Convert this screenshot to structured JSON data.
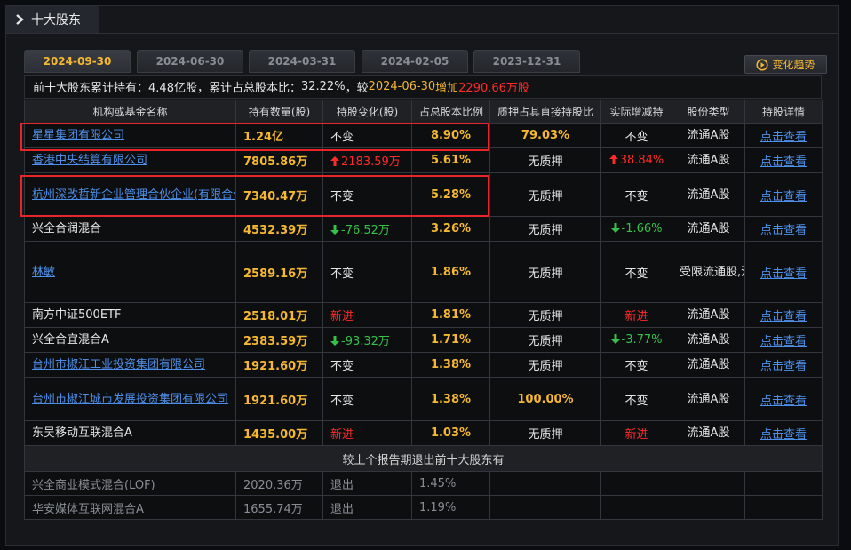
{
  "window": {
    "title": "十大股东"
  },
  "tabs": [
    {
      "label": "2024-09-30",
      "active": true
    },
    {
      "label": "2024-06-30",
      "active": false
    },
    {
      "label": "2024-03-31",
      "active": false
    },
    {
      "label": "2024-02-05",
      "active": false
    },
    {
      "label": "2023-12-31",
      "active": false
    }
  ],
  "trend_button": {
    "label": "变化趋势",
    "icon": "play-circle-icon"
  },
  "summary": {
    "prefix": "前十大股东累计持有：",
    "held": "4.48亿股",
    "mid": "，累计占总股本比：",
    "ratio": "32.22%",
    "mid2": "，较",
    "compare_date": "2024-06-30",
    "change_word": "增加",
    "change_value": "2290.66万股"
  },
  "table": {
    "headers": [
      "机构或基金名称",
      "持有数量(股)",
      "持股变化(股)",
      "占总股本比例",
      "质押占其直接持股比",
      "实际增减持",
      "股份类型",
      "持股详情"
    ],
    "rows": [
      {
        "name": "星星集团有限公司",
        "link": true,
        "amount": "1.24亿",
        "change": "不变",
        "change_dir": "none",
        "ratio": "8.90%",
        "pledge": "79.03%",
        "pledge_hl": true,
        "actual": "不变",
        "actual_dir": "none",
        "type": "流通A股",
        "detail": "点击查看"
      },
      {
        "name": "香港中央结算有限公司",
        "link": true,
        "amount": "7805.86万",
        "change": "2183.59万",
        "change_dir": "up",
        "ratio": "5.61%",
        "pledge": "无质押",
        "pledge_hl": false,
        "actual": "38.84%",
        "actual_dir": "up",
        "type": "流通A股",
        "detail": "点击查看"
      },
      {
        "name": "杭州深改哲新企业管理合伙企业(有限合伙)",
        "link": true,
        "amount": "7340.47万",
        "change": "不变",
        "change_dir": "none",
        "ratio": "5.28%",
        "pledge": "无质押",
        "pledge_hl": false,
        "actual": "不变",
        "actual_dir": "none",
        "type": "流通A股",
        "detail": "点击查看"
      },
      {
        "name": "兴全合润混合",
        "link": false,
        "amount": "4532.39万",
        "change": "-76.52万",
        "change_dir": "down",
        "ratio": "3.26%",
        "pledge": "无质押",
        "pledge_hl": false,
        "actual": "-1.66%",
        "actual_dir": "down",
        "type": "流通A股",
        "detail": "点击查看"
      },
      {
        "name": "林敏",
        "link": true,
        "amount": "2589.16万",
        "change": "不变",
        "change_dir": "none",
        "ratio": "1.86%",
        "pledge": "无质押",
        "pledge_hl": false,
        "actual": "不变",
        "actual_dir": "none",
        "type": "受限流通股,流通A股",
        "detail": "点击查看"
      },
      {
        "name": "南方中证500ETF",
        "link": false,
        "amount": "2518.01万",
        "change": "新进",
        "change_dir": "new",
        "ratio": "1.81%",
        "pledge": "无质押",
        "pledge_hl": false,
        "actual": "新进",
        "actual_dir": "new",
        "type": "流通A股",
        "detail": "点击查看"
      },
      {
        "name": "兴全合宜混合A",
        "link": false,
        "amount": "2383.59万",
        "change": "-93.32万",
        "change_dir": "down",
        "ratio": "1.71%",
        "pledge": "无质押",
        "pledge_hl": false,
        "actual": "-3.77%",
        "actual_dir": "down",
        "type": "流通A股",
        "detail": "点击查看"
      },
      {
        "name": "台州市椒江工业投资集团有限公司",
        "link": true,
        "amount": "1921.60万",
        "change": "不变",
        "change_dir": "none",
        "ratio": "1.38%",
        "pledge": "无质押",
        "pledge_hl": false,
        "actual": "不变",
        "actual_dir": "none",
        "type": "流通A股",
        "detail": "点击查看"
      },
      {
        "name": "台州市椒江城市发展投资集团有限公司",
        "link": true,
        "amount": "1921.60万",
        "change": "不变",
        "change_dir": "none",
        "ratio": "1.38%",
        "pledge": "100.00%",
        "pledge_hl": true,
        "actual": "不变",
        "actual_dir": "none",
        "type": "流通A股",
        "detail": "点击查看"
      },
      {
        "name": "东吴移动互联混合A",
        "link": false,
        "amount": "1435.00万",
        "change": "新进",
        "change_dir": "new",
        "ratio": "1.03%",
        "pledge": "无质押",
        "pledge_hl": false,
        "actual": "新进",
        "actual_dir": "new",
        "type": "流通A股",
        "detail": "点击查看"
      }
    ],
    "exit_section_title": "较上个报告期退出前十大股东有",
    "exit_rows": [
      {
        "name": "兴全商业模式混合(LOF)",
        "amount": "2020.36万",
        "change": "退出",
        "ratio": "1.45%"
      },
      {
        "name": "华安媒体互联网混合A",
        "amount": "1655.74万",
        "change": "退出",
        "ratio": "1.19%"
      }
    ]
  },
  "colors": {
    "accent": "#f5b830",
    "up": "#ff2a2a",
    "down": "#36c24a",
    "link": "#4d8fe8",
    "highlight_box": "#e8262a"
  }
}
